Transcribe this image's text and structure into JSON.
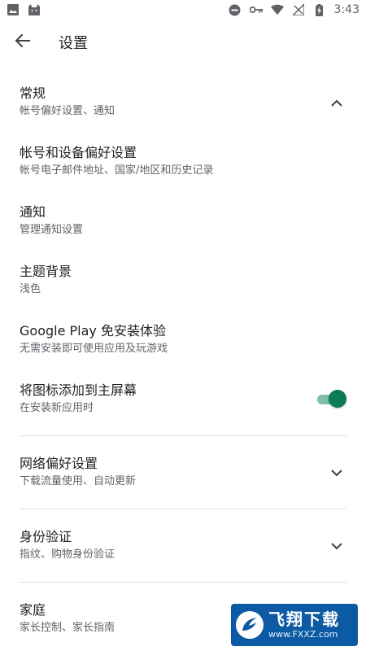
{
  "status_bar": {
    "time": "3:43",
    "left_icons": [
      "image-icon",
      "android-cat-icon"
    ],
    "right_icons": [
      "do-not-disturb-icon",
      "vpn-key-icon",
      "wifi-icon",
      "no-signal-icon",
      "battery-charging-icon"
    ]
  },
  "app_bar": {
    "title": "设置",
    "back_icon": "arrow-back-icon"
  },
  "sections": [
    {
      "title": "常规",
      "subtitle": "帐号偏好设置、通知",
      "control": "chevron-up-icon"
    },
    {
      "title": "帐号和设备偏好设置",
      "subtitle": "帐号电子邮件地址、国家/地区和历史记录"
    },
    {
      "title": "通知",
      "subtitle": "管理通知设置"
    },
    {
      "title": "主题背景",
      "subtitle": "浅色"
    },
    {
      "title": "Google Play 免安装体验",
      "subtitle": "无需安装即可使用应用及玩游戏"
    },
    {
      "title": "将图标添加到主屏幕",
      "subtitle": "在安装新应用时",
      "control": "toggle",
      "toggle_on": true
    },
    {
      "title": "网络偏好设置",
      "subtitle": "下载流量使用、自动更新",
      "control": "chevron-down-icon"
    },
    {
      "title": "身份验证",
      "subtitle": "指纹、购物身份验证",
      "control": "chevron-down-icon"
    },
    {
      "title": "家庭",
      "subtitle": "家长控制、家长指南"
    }
  ],
  "colors": {
    "toggle_thumb": "#0b7a55",
    "toggle_track": "#7fbfa6",
    "divider": "#e0e0e0"
  },
  "watermark": {
    "main": "飞翔下载",
    "url": "www.FXXZ.com"
  }
}
